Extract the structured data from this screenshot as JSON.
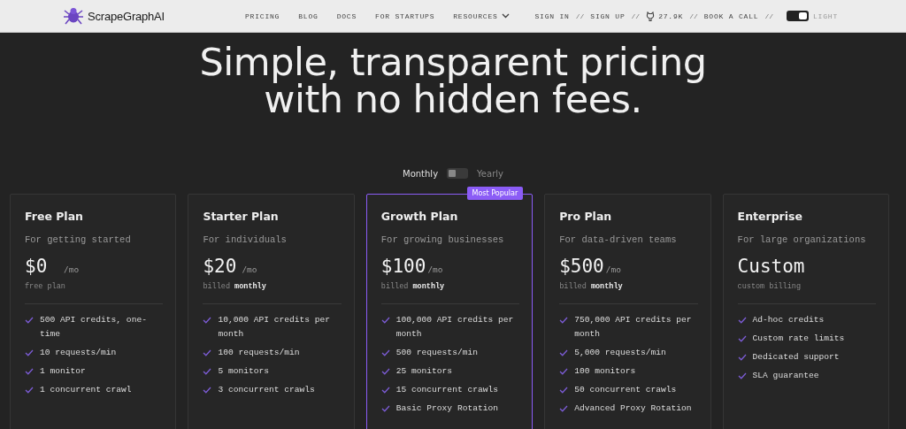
{
  "nav": {
    "logo": "ScrapeGraphAI",
    "links": [
      {
        "label": "PRICING",
        "dropdown": false
      },
      {
        "label": "BLOG",
        "dropdown": false
      },
      {
        "label": "DOCS",
        "dropdown": false
      },
      {
        "label": "FOR STARTUPS",
        "dropdown": false
      },
      {
        "label": "RESOURCES",
        "dropdown": true
      }
    ],
    "right_items": [
      {
        "kind": "link",
        "label": "SIGN IN"
      },
      {
        "kind": "separator",
        "label": "//"
      },
      {
        "kind": "link",
        "label": "SIGN UP"
      },
      {
        "kind": "separator",
        "label": "//"
      },
      {
        "kind": "github",
        "label": "27.9K"
      },
      {
        "kind": "separator",
        "label": "//"
      },
      {
        "kind": "link",
        "label": "BOOK A CALL"
      },
      {
        "kind": "separator",
        "label": "//"
      },
      {
        "kind": "theme",
        "label": "LIGHT",
        "on": true
      }
    ]
  },
  "hero": {
    "title": "Simple, transparent pricing with no hidden fees."
  },
  "billing_toggle": {
    "left": "Monthly",
    "right": "Yearly",
    "on": false
  },
  "plans": [
    {
      "name": "Free Plan",
      "tagline": "For getting started",
      "price": "$0",
      "unit": "/mo",
      "note": "free plan",
      "highlighted": false,
      "features": [
        "500 API credits, one-time",
        "10 requests/min",
        "1 monitor",
        "1 concurrent crawl"
      ]
    },
    {
      "name": "Starter Plan",
      "tagline": "For individuals",
      "price": "$20",
      "unit": "/mo",
      "note": "billed **monthly**",
      "highlighted": false,
      "features": [
        "10,000 API credits per month",
        "100 requests/min",
        "5 monitors",
        "3 concurrent crawls"
      ]
    },
    {
      "name": "Growth Plan",
      "tagline": "For growing businesses",
      "price": "$100",
      "unit": "/mo",
      "note": "billed **monthly**",
      "highlighted": true,
      "badge": "Most Popular",
      "features": [
        "100,000 API credits per month",
        "500 requests/min",
        "25 monitors",
        "15 concurrent crawls",
        "Basic Proxy Rotation"
      ]
    },
    {
      "name": "Pro Plan",
      "tagline": "For data-driven teams",
      "price": "$500",
      "unit": "/mo",
      "note": "billed **monthly**",
      "highlighted": false,
      "features": [
        "750,000 API credits per month",
        "5,000 requests/min",
        "100 monitors",
        "50 concurrent crawls",
        "Advanced Proxy Rotation"
      ]
    },
    {
      "name": "Enterprise",
      "tagline": "For large organizations",
      "price": "Custom",
      "note": "custom billing",
      "highlighted": false,
      "features": [
        "Ad-hoc credits",
        "Custom rate limits",
        "Dedicated support",
        "SLA guarantee"
      ]
    }
  ]
}
